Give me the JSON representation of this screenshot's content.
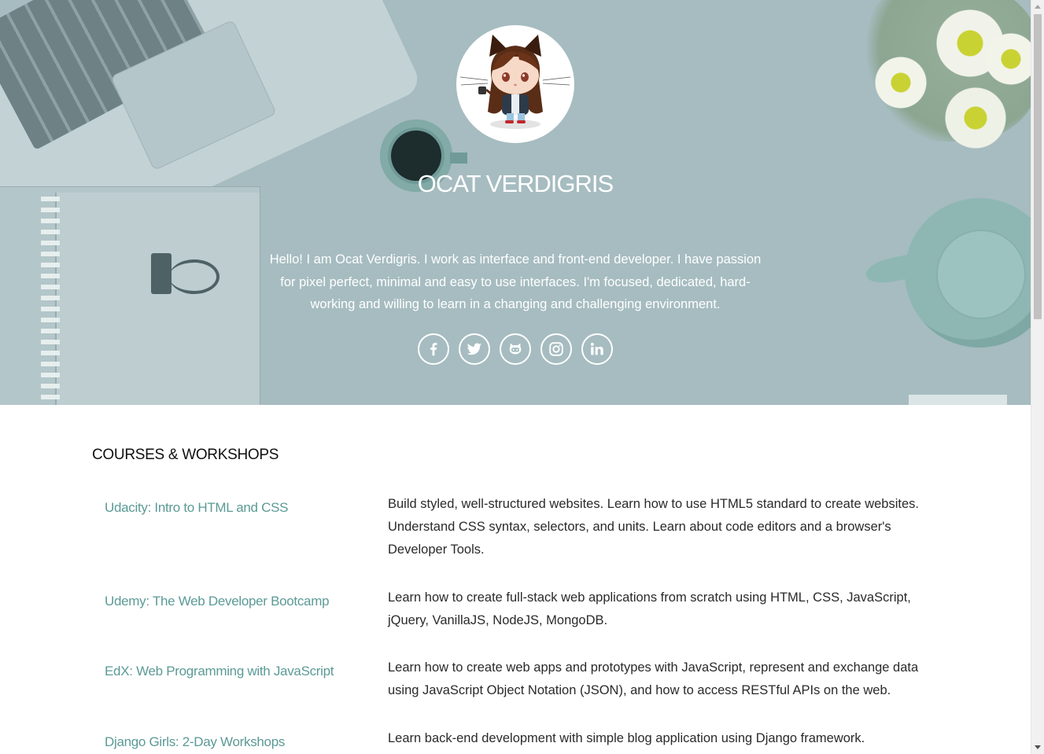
{
  "profile": {
    "name": "OCAT VERDIGRIS",
    "bio": "Hello! I am Ocat Verdigris. I work as interface and front-end developer. I have passion for pixel perfect, minimal and easy to use interfaces. I'm focused, dedicated, hard-working and willing to learn in a changing and challenging environment."
  },
  "social": [
    {
      "name": "facebook-icon"
    },
    {
      "name": "twitter-icon"
    },
    {
      "name": "github-icon"
    },
    {
      "name": "instagram-icon"
    },
    {
      "name": "linkedin-icon"
    }
  ],
  "courses": {
    "section_title": "COURSES & WORKSHOPS",
    "items": [
      {
        "title": "Udacity: Intro to HTML and CSS",
        "description": "Build styled, well-structured websites. Learn how to use HTML5 standard to create websites. Understand CSS syntax, selectors, and units. Learn about code editors and a browser's Developer Tools."
      },
      {
        "title": "Udemy: The Web Developer Bootcamp",
        "description": "Learn how to create full-stack web applications from scratch using HTML, CSS, JavaScript, jQuery, VanillaJS, NodeJS, MongoDB."
      },
      {
        "title": "EdX: Web Programming with JavaScript",
        "description": "Learn how to create web apps and prototypes with JavaScript, represent and exchange data using JavaScript Object Notation (JSON), and how to access RESTful APIs on the web."
      },
      {
        "title": "Django Girls: 2-Day Workshops",
        "description": "Learn back-end development with simple blog application using Django framework."
      }
    ]
  },
  "colors": {
    "hero_background": "#a6bcc0",
    "accent_teal": "#5b9a96",
    "text": "#2a2a2a"
  }
}
